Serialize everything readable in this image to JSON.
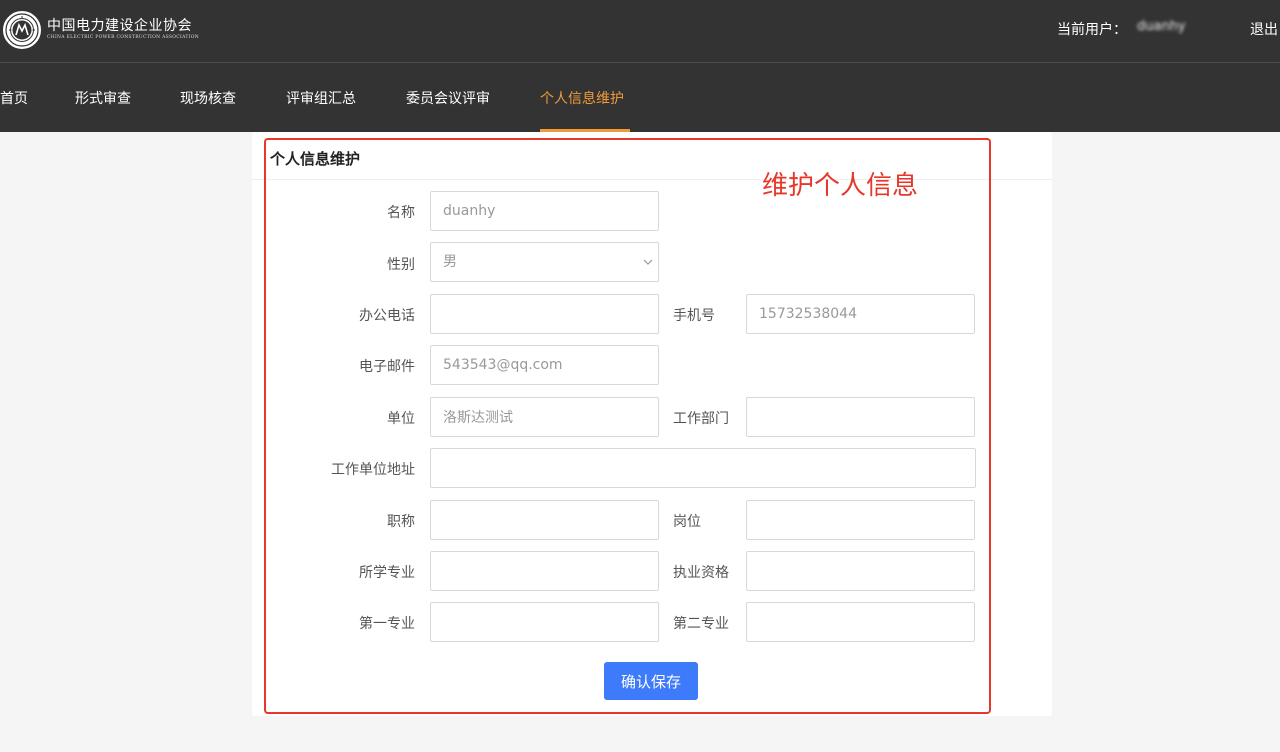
{
  "header": {
    "org_name": "中国电力建设企业协会",
    "org_name_en": "CHINA ELECTRIC POWER CONSTRUCTION ASSOCIATION",
    "user_label": "当前用户：",
    "user_name": "duanhy",
    "logout": "退出",
    "bg_color": "#333333"
  },
  "nav": {
    "items": [
      {
        "label": "首页"
      },
      {
        "label": "形式审查"
      },
      {
        "label": "现场核查"
      },
      {
        "label": "评审组汇总"
      },
      {
        "label": "委员会议评审"
      },
      {
        "label": "个人信息维护"
      }
    ],
    "active_index": 5,
    "active_color": "#f09b39"
  },
  "card": {
    "title": "个人信息维护"
  },
  "annotation": {
    "text": "维护个人信息",
    "color": "#e5382a"
  },
  "form": {
    "name": {
      "label": "名称",
      "value": "duanhy"
    },
    "gender": {
      "label": "性别",
      "value": "男"
    },
    "office_phone": {
      "label": "办公电话",
      "value": ""
    },
    "mobile": {
      "label": "手机号",
      "value": "15732538044"
    },
    "email": {
      "label": "电子邮件",
      "value": "543543@qq.com"
    },
    "company": {
      "label": "单位",
      "value": "洛斯达测试"
    },
    "department": {
      "label": "工作部门",
      "value": ""
    },
    "company_address": {
      "label": "工作单位地址",
      "value": ""
    },
    "job_title": {
      "label": "职称",
      "value": ""
    },
    "position": {
      "label": "岗位",
      "value": ""
    },
    "major": {
      "label": "所学专业",
      "value": ""
    },
    "qualification": {
      "label": "执业资格",
      "value": ""
    },
    "first_major": {
      "label": "第一专业",
      "value": ""
    },
    "second_major": {
      "label": "第二专业",
      "value": ""
    },
    "save_label": "确认保存",
    "save_color": "#3e7bfa"
  }
}
